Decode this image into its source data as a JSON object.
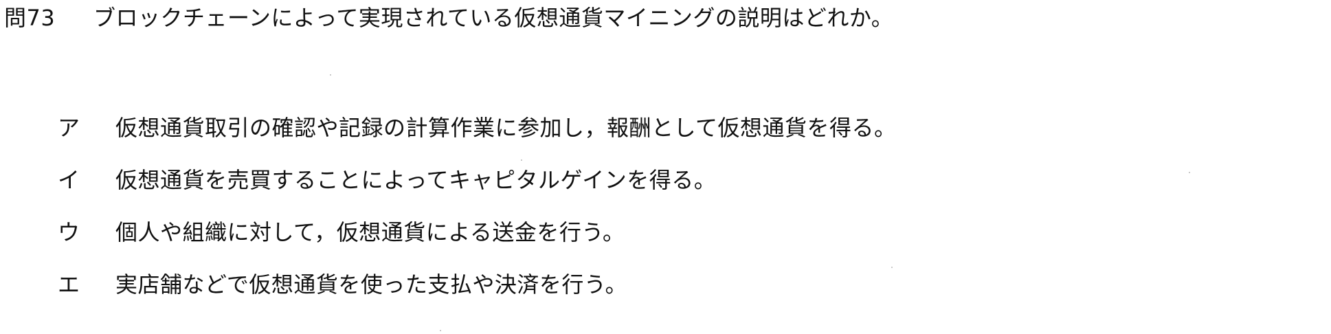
{
  "question": {
    "number": "問73",
    "text": "ブロックチェーンによって実現されている仮想通貨マイニングの説明はどれか。"
  },
  "choices": [
    {
      "label": "ア",
      "text": "仮想通貨取引の確認や記録の計算作業に参加し，報酬として仮想通貨を得る。"
    },
    {
      "label": "イ",
      "text": "仮想通貨を売買することによってキャピタルゲインを得る。"
    },
    {
      "label": "ウ",
      "text": "個人や組織に対して，仮想通貨による送金を行う。"
    },
    {
      "label": "エ",
      "text": "実店舗などで仮想通貨を使った支払や決済を行う。"
    }
  ]
}
